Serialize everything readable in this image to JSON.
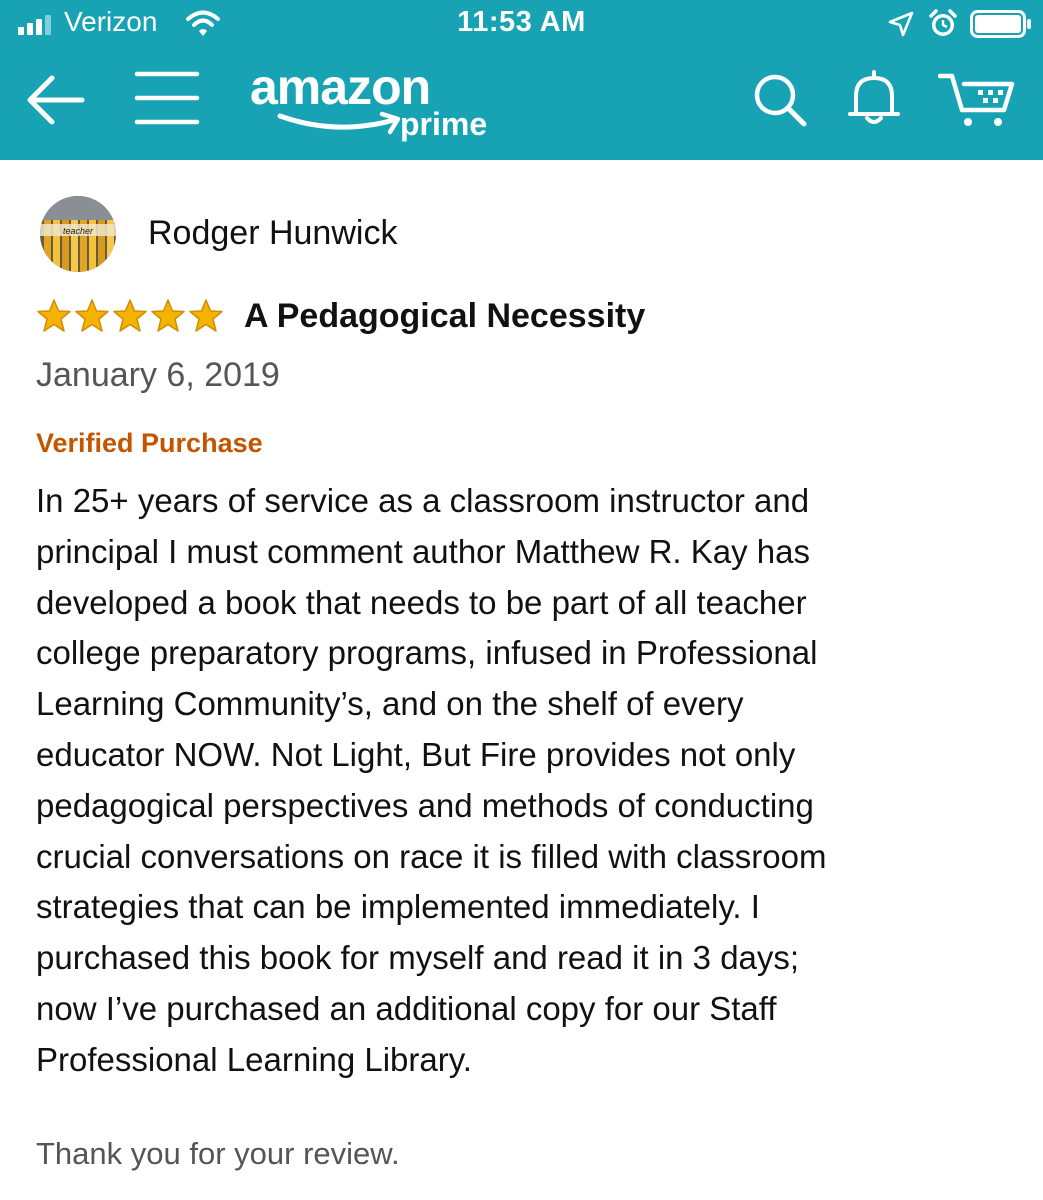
{
  "status_bar": {
    "carrier": "Verizon",
    "time": "11:53 AM",
    "icons": [
      "signal-icon",
      "wifi-icon",
      "location-arrow-icon",
      "alarm-clock-icon",
      "battery-icon"
    ]
  },
  "nav": {
    "logo_word": "amazon",
    "logo_sub": "prime",
    "icons": [
      "back-arrow-icon",
      "hamburger-menu-icon",
      "search-icon",
      "bell-icon",
      "cart-icon"
    ]
  },
  "review": {
    "reviewer_name": "Rodger Hunwick",
    "avatar_text": "teacher",
    "rating": 5,
    "rating_max": 5,
    "title": "A Pedagogical Necessity",
    "date": "January 6, 2019",
    "verified": "Verified Purchase",
    "body_lines": [
      "In 25+ years of service as a classroom instructor and",
      "principal I must comment author Matthew R. Kay has",
      "developed a book that needs to be part of all teacher",
      "college preparatory programs, infused in Professional",
      "Learning Community’s, and on the shelf of every",
      "educator NOW. Not Light, But Fire provides not only",
      "pedagogical perspectives and methods of conducting",
      "crucial conversations on race it is filled with classroom",
      "strategies that can be implemented immediately. I",
      "purchased this book for myself and read it in 3 days;",
      "now I’ve purchased an additional copy for our Staff",
      "Professional Learning Library."
    ],
    "thanks": "Thank you for your review."
  },
  "colors": {
    "header_bg": "#17a3b4",
    "star": "#f5b301",
    "verified": "#c45500",
    "muted_text": "#555555"
  }
}
